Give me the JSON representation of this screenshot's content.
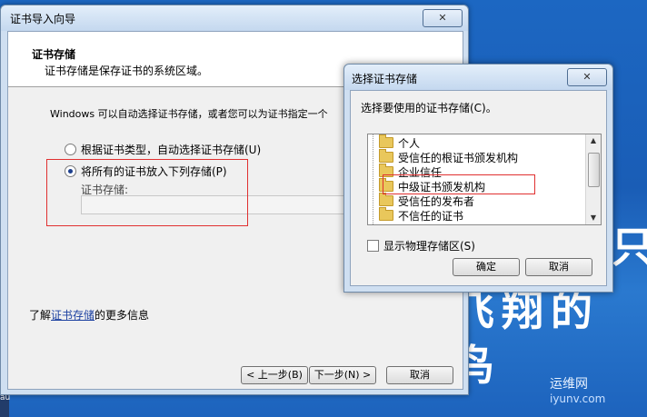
{
  "wizard": {
    "title": "证书导入向导",
    "close_label": "✕",
    "header_title": "证书存储",
    "header_subtitle": "证书存储是保存证书的系统区域。",
    "description": "Windows 可以自动选择证书存储，或者您可以为证书指定一个",
    "radio_auto": "根据证书类型，自动选择证书存储(U)",
    "radio_manual": "将所有的证书放入下列存储(P)",
    "store_label": "证书存储:",
    "store_value": "",
    "learn_prefix": "了解",
    "learn_link": "证书存储",
    "learn_suffix": "的更多信息",
    "back_button": "< 上一步(B)",
    "next_button": "下一步(N) >",
    "cancel_button": "取消"
  },
  "dialog": {
    "title": "选择证书存储",
    "close_label": "✕",
    "prompt": "选择要使用的证书存储(C)。",
    "stores": [
      "个人",
      "受信任的根证书颁发机构",
      "企业信任",
      "中级证书颁发机构",
      "受信任的发布者",
      "不信任的证书"
    ],
    "selected_store": "受信任的根证书颁发机构",
    "show_physical": "显示物理存储区(S)",
    "ok_button": "确定",
    "cancel_button": "取消"
  },
  "desktop": {
    "glyph_line1": "只",
    "glyph_line2": "飞翔的鸟",
    "watermark_line1": "运维网",
    "watermark_line2": "iyunv.com",
    "taskbar_text": "au"
  },
  "colors": {
    "highlight_box": "#e03030",
    "link": "#1a3fa0",
    "desktop": "#1c67c2"
  }
}
